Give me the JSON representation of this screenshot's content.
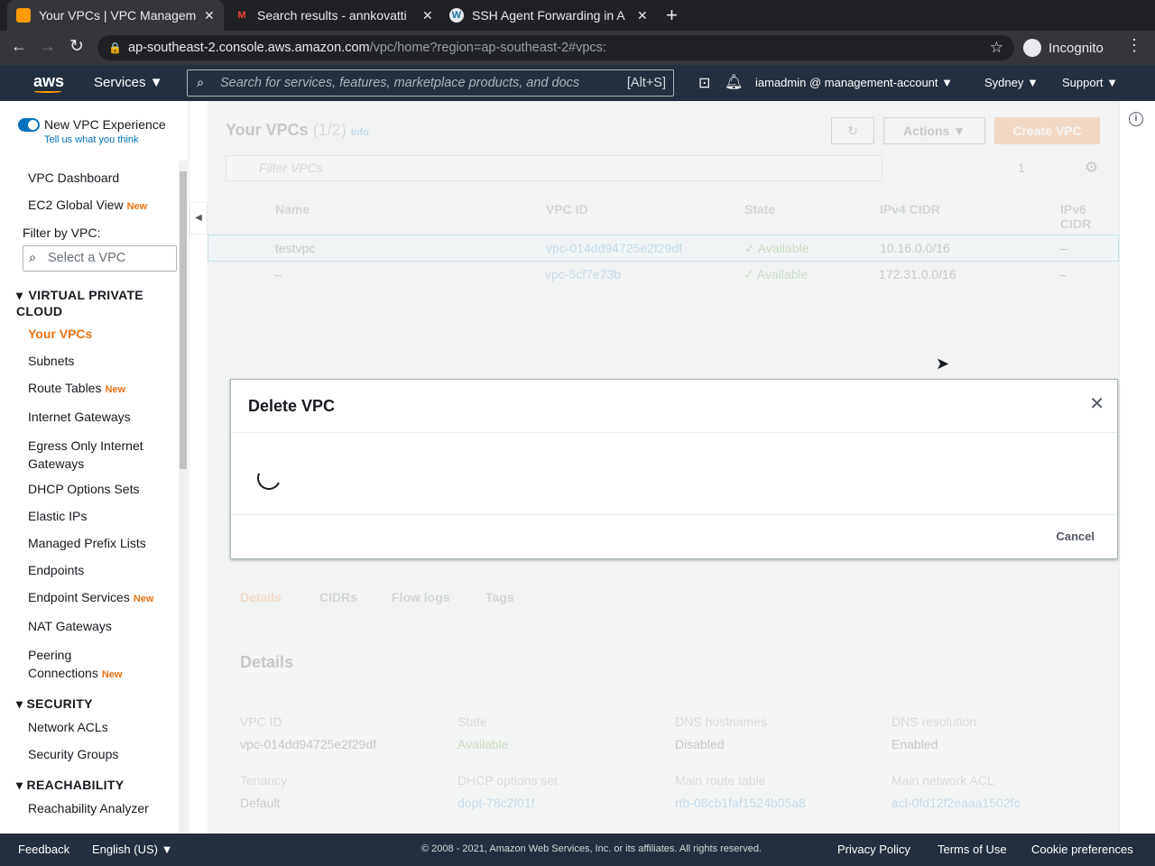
{
  "browser": {
    "tabs": [
      {
        "title": "Your VPCs | VPC Manageme",
        "icon": "aws-box-icon",
        "active": true
      },
      {
        "title": "Search results - annkovatti",
        "icon": "gmail-icon",
        "active": false
      },
      {
        "title": "SSH Agent Forwarding in A",
        "icon": "wordpress-icon",
        "active": false
      }
    ],
    "url_host": "ap-southeast-2.console.aws.amazon.com",
    "url_path": "/vpc/home?region=ap-southeast-2#vpcs:",
    "profile": "Incognito"
  },
  "aws_nav": {
    "logo": "aws",
    "services": "Services",
    "search_placeholder": "Search for services, features, marketplace products, and docs",
    "search_shortcut": "[Alt+S]",
    "account": "iamadmin @ management-account",
    "region": "Sydney",
    "support": "Support"
  },
  "sidebar": {
    "toggle_label": "New VPC Experience",
    "feedback_link": "Tell us what you think",
    "new_badge": "New",
    "top": [
      {
        "label": "VPC Dashboard"
      },
      {
        "label": "EC2 Global View",
        "new": true
      }
    ],
    "filter_label": "Filter by VPC:",
    "filter_placeholder": "Select a VPC",
    "sections": {
      "vpc": "VIRTUAL PRIVATE CLOUD",
      "security": "SECURITY",
      "reachability": "REACHABILITY"
    },
    "vpc_items": [
      "Your VPCs",
      "Subnets",
      "Route Tables",
      "Internet Gateways",
      "Egress Only Internet Gateways",
      "DHCP Options Sets",
      "Elastic IPs",
      "Managed Prefix Lists",
      "Endpoints",
      "Endpoint Services",
      "NAT Gateways",
      "Peering Connections"
    ],
    "security_items": [
      "Network ACLs",
      "Security Groups"
    ],
    "reachability_items": [
      "Reachability Analyzer"
    ]
  },
  "main": {
    "title": "Your VPCs",
    "count": "(1/2)",
    "info": "Info",
    "actions": "Actions",
    "create": "Create VPC",
    "filter_placeholder": "Filter VPCs",
    "page": "1",
    "columns": [
      "Name",
      "VPC ID",
      "State",
      "IPv4 CIDR",
      "IPv6 CIDR"
    ],
    "rows": [
      {
        "name": "testvpc",
        "id": "vpc-014dd94725e2f29df",
        "state": "Available",
        "cidr": "10.16.0.0/16",
        "ipv6": "–",
        "selected": true
      },
      {
        "name": "–",
        "id": "vpc-5cf7e73b",
        "state": "Available",
        "cidr": "172.31.0.0/16",
        "ipv6": "–",
        "selected": false
      }
    ],
    "tabs": [
      "Details",
      "CIDRs",
      "Flow logs",
      "Tags"
    ],
    "details_title": "Details",
    "details": [
      {
        "label": "VPC ID",
        "value": "vpc-014dd94725e2f29df"
      },
      {
        "label": "State",
        "value": "Available"
      },
      {
        "label": "DNS hostnames",
        "value": "Disabled"
      },
      {
        "label": "DNS resolution",
        "value": "Enabled"
      },
      {
        "label": "Tenancy",
        "value": "Default"
      },
      {
        "label": "DHCP options set",
        "value": "dopt-78c2f01f"
      },
      {
        "label": "Main route table",
        "value": "rtb-08cb1faf1524b05a8"
      },
      {
        "label": "Main network ACL",
        "value": "acl-0fd12f2eaaa1502fc"
      }
    ]
  },
  "dialog": {
    "title": "Delete VPC",
    "cancel": "Cancel"
  },
  "footer": {
    "feedback": "Feedback",
    "language": "English (US)",
    "copyright": "© 2008 - 2021, Amazon Web Services, Inc. or its affiliates. All rights reserved.",
    "privacy": "Privacy Policy",
    "terms": "Terms of Use",
    "cookies": "Cookie preferences"
  },
  "colors": {
    "accent": "#ec7211",
    "nav": "#232f3e",
    "link": "#0073bb"
  }
}
